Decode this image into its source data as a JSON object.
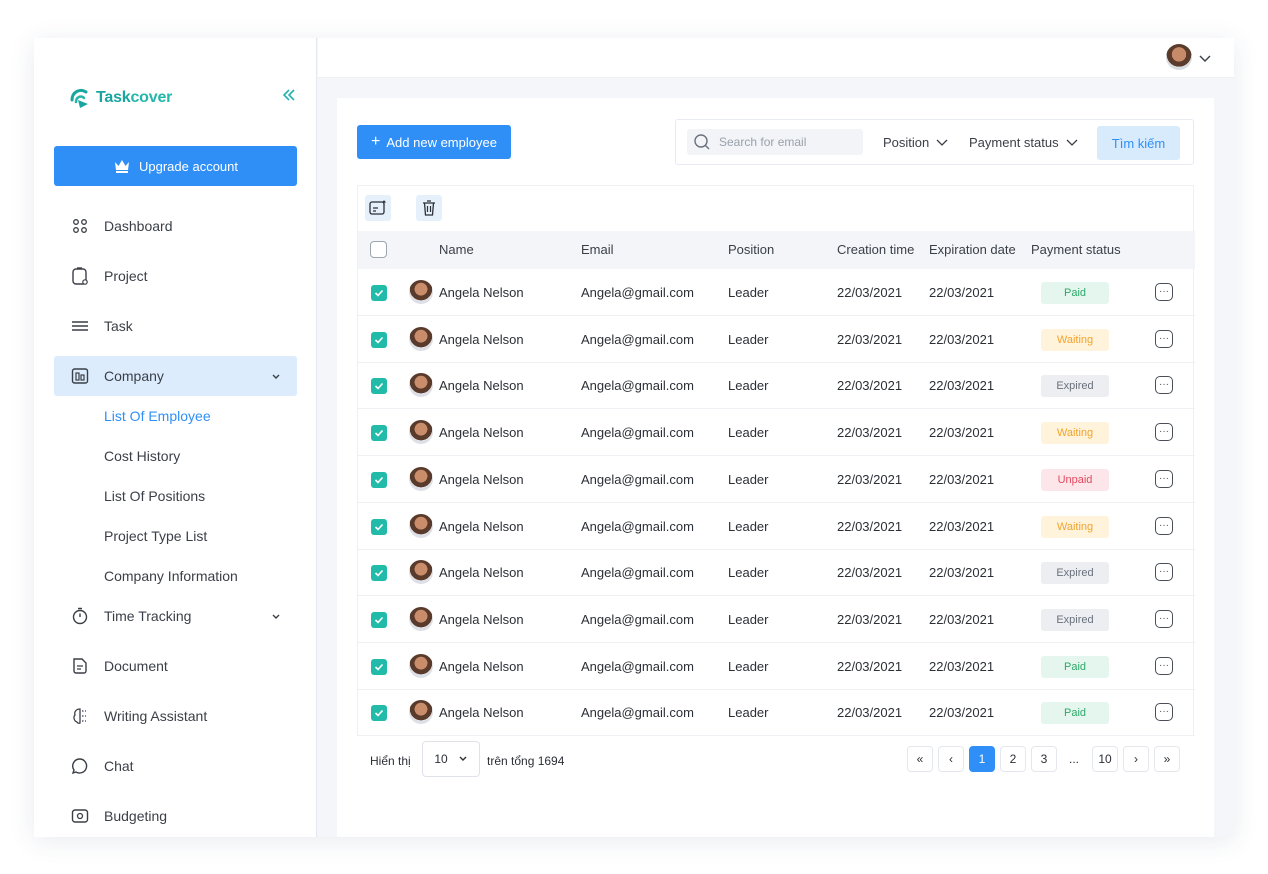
{
  "app": {
    "logo_text_a": "Task",
    "logo_text_b": "cover"
  },
  "sidebar": {
    "upgrade_label": "Upgrade account",
    "items": [
      {
        "label": "Dashboard",
        "icon": "dashboard-icon"
      },
      {
        "label": "Project",
        "icon": "project-icon"
      },
      {
        "label": "Task",
        "icon": "task-icon"
      },
      {
        "label": "Company",
        "icon": "company-icon"
      },
      {
        "label": "Time Tracking",
        "icon": "stopwatch-icon"
      },
      {
        "label": "Document",
        "icon": "document-icon"
      },
      {
        "label": "Writing Assistant",
        "icon": "writing-assistant-icon"
      },
      {
        "label": "Chat",
        "icon": "chat-icon"
      },
      {
        "label": "Budgeting",
        "icon": "budgeting-icon"
      }
    ],
    "company_sub": [
      "List Of Employee",
      "Cost History",
      "List Of Positions",
      "Project Type List",
      "Company Information"
    ]
  },
  "toolbar": {
    "add_label": "Add new employee",
    "search_placeholder": "Search for email",
    "position_label": "Position",
    "payment_status_label": "Payment status",
    "search_button": "Tìm kiếm"
  },
  "table": {
    "columns": [
      "Name",
      "Email",
      "Position",
      "Creation time",
      "Expiration date",
      "Payment status"
    ],
    "rows": [
      {
        "name": "Angela Nelson",
        "email": "Angela@gmail.com",
        "position": "Leader",
        "created": "22/03/2021",
        "expires": "22/03/2021",
        "status": "Paid",
        "kind": "paid"
      },
      {
        "name": "Angela Nelson",
        "email": "Angela@gmail.com",
        "position": "Leader",
        "created": "22/03/2021",
        "expires": "22/03/2021",
        "status": "Waiting",
        "kind": "waiting"
      },
      {
        "name": "Angela Nelson",
        "email": "Angela@gmail.com",
        "position": "Leader",
        "created": "22/03/2021",
        "expires": "22/03/2021",
        "status": "Expired",
        "kind": "expired"
      },
      {
        "name": "Angela Nelson",
        "email": "Angela@gmail.com",
        "position": "Leader",
        "created": "22/03/2021",
        "expires": "22/03/2021",
        "status": "Waiting",
        "kind": "waiting"
      },
      {
        "name": "Angela Nelson",
        "email": "Angela@gmail.com",
        "position": "Leader",
        "created": "22/03/2021",
        "expires": "22/03/2021",
        "status": "Unpaid",
        "kind": "unpaid"
      },
      {
        "name": "Angela Nelson",
        "email": "Angela@gmail.com",
        "position": "Leader",
        "created": "22/03/2021",
        "expires": "22/03/2021",
        "status": "Waiting",
        "kind": "waiting"
      },
      {
        "name": "Angela Nelson",
        "email": "Angela@gmail.com",
        "position": "Leader",
        "created": "22/03/2021",
        "expires": "22/03/2021",
        "status": "Expired",
        "kind": "expired"
      },
      {
        "name": "Angela Nelson",
        "email": "Angela@gmail.com",
        "position": "Leader",
        "created": "22/03/2021",
        "expires": "22/03/2021",
        "status": "Expired",
        "kind": "expired"
      },
      {
        "name": "Angela Nelson",
        "email": "Angela@gmail.com",
        "position": "Leader",
        "created": "22/03/2021",
        "expires": "22/03/2021",
        "status": "Paid",
        "kind": "paid"
      },
      {
        "name": "Angela Nelson",
        "email": "Angela@gmail.com",
        "position": "Leader",
        "created": "22/03/2021",
        "expires": "22/03/2021",
        "status": "Paid",
        "kind": "paid"
      }
    ]
  },
  "footer": {
    "show_label": "Hiển thị",
    "page_size": "10",
    "total_label": "trên tổng 1694",
    "pages": [
      "1",
      "2",
      "3",
      "...",
      "10"
    ],
    "current_page": "1"
  },
  "colors": {
    "accent": "#2f8ff7",
    "brand": "#23b7a9",
    "checkbox": "#22bba9"
  }
}
